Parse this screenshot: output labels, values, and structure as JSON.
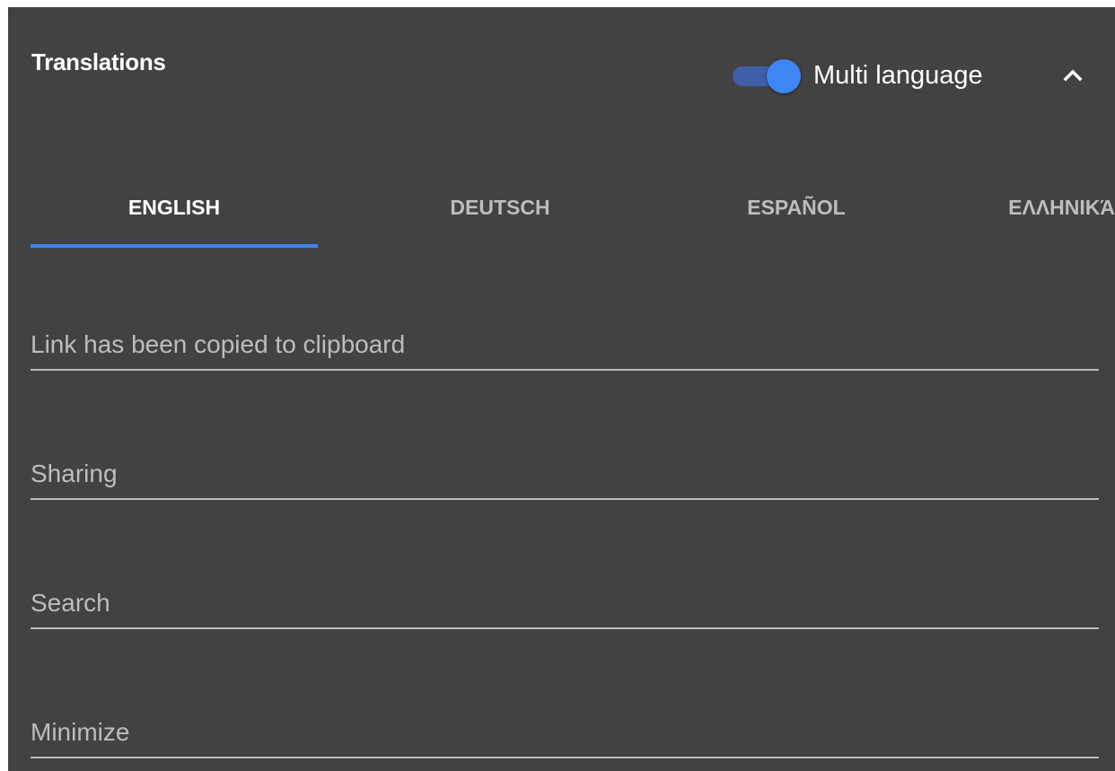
{
  "header": {
    "title": "Translations",
    "multi_language": {
      "label": "Multi language",
      "enabled": true
    },
    "collapse_icon": "chevron-up-icon"
  },
  "tabs": [
    {
      "label": "ENGLISH",
      "active": true
    },
    {
      "label": "DEUTSCH",
      "active": false
    },
    {
      "label": "ESPAÑOL",
      "active": false
    },
    {
      "label": "ΕΛΛΗΝΙΚΆ",
      "active": false
    }
  ],
  "fields": [
    {
      "placeholder": "Link has been copied to clipboard",
      "value": ""
    },
    {
      "placeholder": "Sharing",
      "value": ""
    },
    {
      "placeholder": "Search",
      "value": ""
    },
    {
      "placeholder": "Minimize",
      "value": ""
    }
  ],
  "colors": {
    "panel_background": "#424242",
    "accent": "#3d86f4",
    "toggle_track": "#3f5fa8",
    "inactive_text": "#bdbdbd"
  }
}
